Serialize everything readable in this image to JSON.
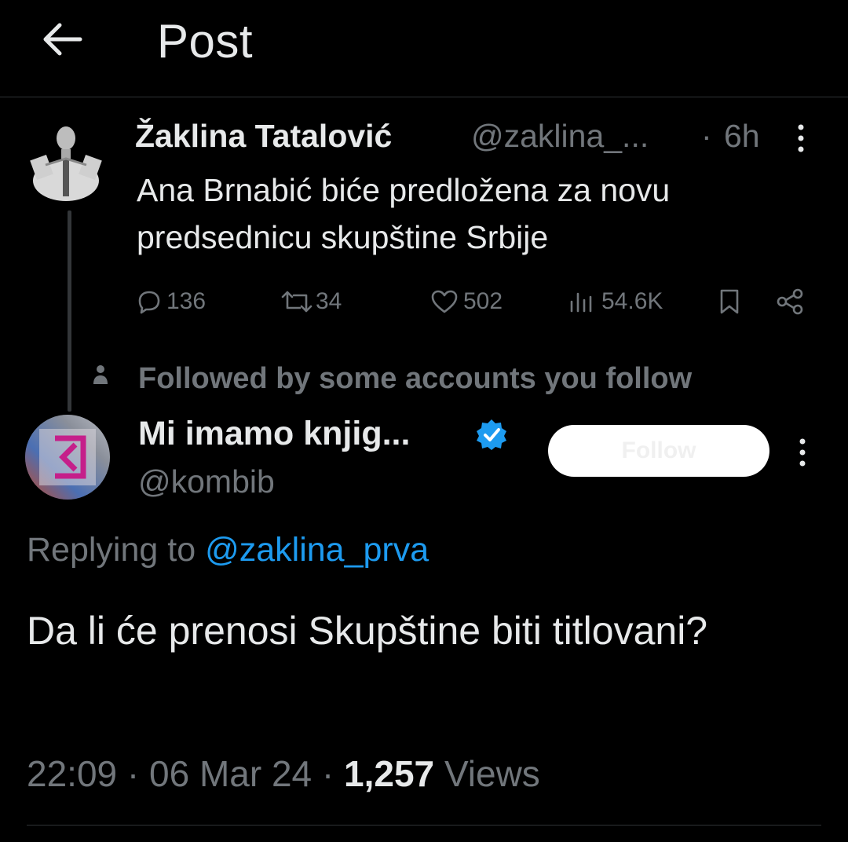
{
  "header": {
    "title": "Post"
  },
  "parent_tweet": {
    "author_name": "Žaklina Tatalović",
    "handle": "@zaklina_...",
    "separator": "·",
    "time": "6h",
    "text": "Ana Brnabić biće predložena za novu predsednicu skupštine Srbije",
    "stats": {
      "replies": "136",
      "reposts": "34",
      "likes": "502",
      "views": "54.6K"
    }
  },
  "social_context": {
    "text": "Followed by some accounts you follow"
  },
  "reply": {
    "author_name": "Mi imamo knjig...",
    "handle": "@kombib",
    "follow_label": "Follow",
    "replying_prefix": "Replying to",
    "replying_handle": "@zaklina_prva",
    "text": "Da li će prenosi Skupštine biti titlovani?",
    "time": "22:09",
    "date": "06 Mar 24",
    "views_count": "1,257",
    "views_label": "Views",
    "separator": "·"
  },
  "colors": {
    "background": "#000000",
    "text": "#e7e9ea",
    "muted": "#71767b",
    "link": "#1d9bf0",
    "verified": "#1d9bf0"
  }
}
